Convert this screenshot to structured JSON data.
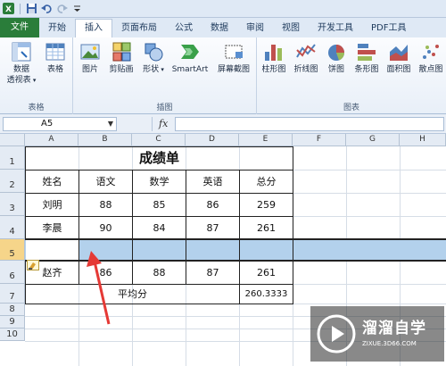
{
  "title_bar": {
    "icons": [
      "excel-icon",
      "save-icon",
      "undo-icon",
      "redo-icon",
      "customize-qat-icon"
    ]
  },
  "tabs": [
    "文件",
    "开始",
    "插入",
    "页面布局",
    "公式",
    "数据",
    "审阅",
    "视图",
    "开发工具",
    "PDF工具"
  ],
  "active_tab": "插入",
  "ribbon": {
    "groups": [
      {
        "label": "表格",
        "buttons": [
          "数据\n透视表",
          "表格"
        ]
      },
      {
        "label": "插图",
        "buttons": [
          "图片",
          "剪贴画",
          "形状",
          "SmartArt",
          "屏幕截图"
        ]
      },
      {
        "label": "图表",
        "buttons": [
          "柱形图",
          "折线图",
          "饼图",
          "条形图",
          "面积图",
          "散点图"
        ]
      }
    ],
    "pivot_label_line1": "数据",
    "pivot_label_line2": "透视表",
    "table_label": "表格",
    "group_tables": "表格",
    "picture": "图片",
    "clipart": "剪贴画",
    "shapes": "形状",
    "smartart": "SmartArt",
    "screenshot": "屏幕截图",
    "group_illus": "插图",
    "column": "柱形图",
    "line": "折线图",
    "pie": "饼图",
    "bar": "条形图",
    "area": "面积图",
    "scatter": "散点图",
    "group_charts": "图表"
  },
  "formula_bar": {
    "name_box": "A5",
    "fx": "fx",
    "formula": ""
  },
  "columns": [
    "A",
    "B",
    "C",
    "D",
    "E",
    "F",
    "G",
    "H"
  ],
  "rows": [
    "1",
    "2",
    "3",
    "4",
    "5",
    "6",
    "7",
    "8",
    "9",
    "10"
  ],
  "sheet": {
    "title": "成绩单",
    "headers": [
      "姓名",
      "语文",
      "数学",
      "英语",
      "总分"
    ],
    "r3": [
      "刘明",
      "88",
      "85",
      "86",
      "259"
    ],
    "r4": [
      "李晨",
      "90",
      "84",
      "87",
      "261"
    ],
    "r6": [
      "赵齐",
      "86",
      "88",
      "87",
      "261"
    ],
    "avg_label": "平均分",
    "avg_value": "260.3333"
  },
  "watermark": {
    "title": "溜溜自学",
    "url": "ZIXUE.3D66.COM"
  },
  "colors": {
    "file_tab": "#2a7d3a",
    "selection": "#b3d1ec",
    "arrow": "#e53935"
  }
}
